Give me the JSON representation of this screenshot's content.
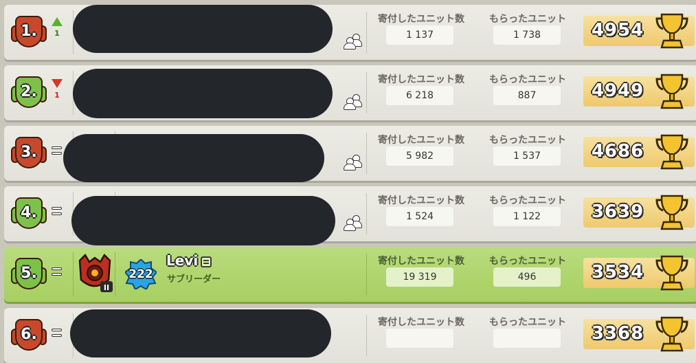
{
  "columns": {
    "donated_label": "寄付したユニット数",
    "received_label": "もらったユニット"
  },
  "rows": [
    {
      "rank": "1.",
      "shield": "red",
      "change": "up",
      "change_amount": "1",
      "donated": "1 137",
      "received": "1 738",
      "trophies": "4954"
    },
    {
      "rank": "2.",
      "shield": "green",
      "change": "down",
      "change_amount": "1",
      "donated": "6 218",
      "received": "887",
      "trophies": "4949"
    },
    {
      "rank": "3.",
      "shield": "red",
      "change": "same",
      "change_amount": "",
      "donated": "5 982",
      "received": "1 537",
      "trophies": "4686"
    },
    {
      "rank": "4.",
      "shield": "green",
      "change": "same",
      "change_amount": "",
      "donated": "1 524",
      "received": "1 122",
      "trophies": "3639"
    },
    {
      "rank": "5.",
      "shield": "green",
      "change": "same",
      "change_amount": "",
      "donated": "19 319",
      "received": "496",
      "trophies": "3534",
      "player": {
        "name": "Levi",
        "role": "サブリーダー",
        "level": "222",
        "avatar_level": "II"
      }
    },
    {
      "rank": "6.",
      "shield": "red",
      "change": "same",
      "change_amount": "",
      "donated": "",
      "received": "",
      "trophies": "3368"
    }
  ],
  "colors": {
    "highlight_row": "#b3d870",
    "row_bg": "#e8e7e0",
    "trophy_bg": "#f3d58a",
    "rank_up": "#57b32c",
    "rank_down": "#d8342b"
  },
  "icons": [
    "rank-shield-icon",
    "rank-up-icon",
    "rank-down-icon",
    "rank-same-icon",
    "clan-members-icon",
    "trophy-icon",
    "chat-icon",
    "experience-level-icon"
  ]
}
